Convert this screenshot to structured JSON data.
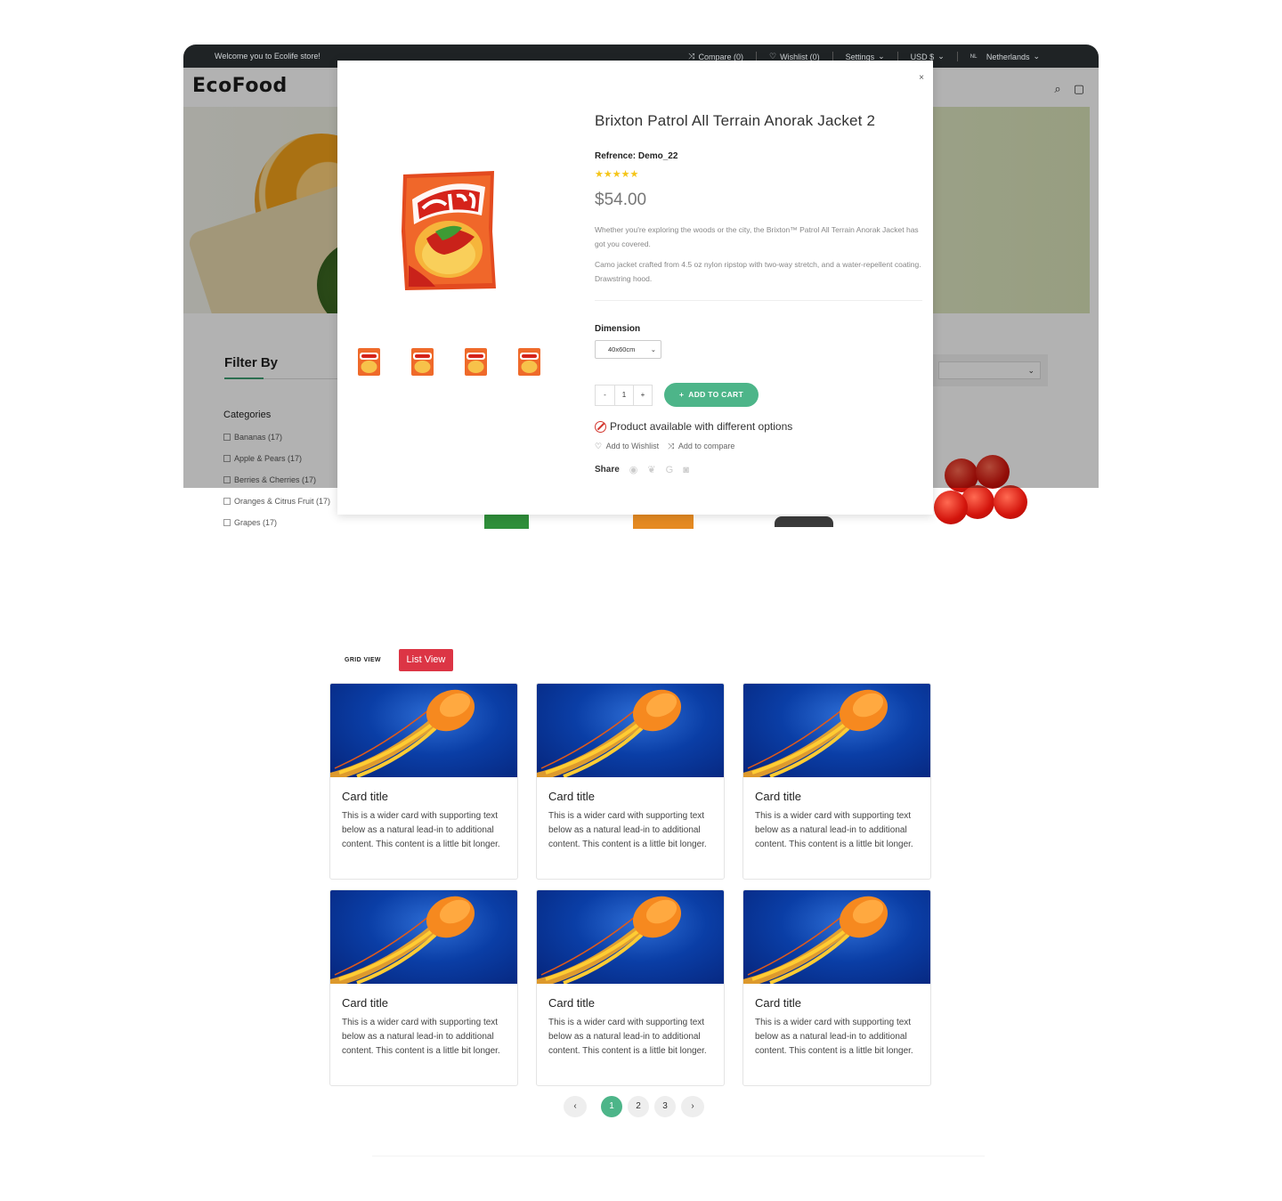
{
  "topbar": {
    "welcome": "Welcome you to Ecolife store!",
    "compare": "Compare (0)",
    "wishlist": "Wishlist (0)",
    "settings": "Settings",
    "currency": "USD $",
    "lang_code": "NL",
    "country": "Netherlands"
  },
  "header": {
    "logo": "EcoFood"
  },
  "sidebar": {
    "filter_title": "Filter By",
    "categories_title": "Categories",
    "categories": [
      "Bananas (17)",
      "Apple & Pears (17)",
      "Berries & Cherries (17)",
      "Oranges & Citrus Fruit (17)",
      "Grapes (17)"
    ]
  },
  "modal": {
    "close": "×",
    "title": "Brixton Patrol All Terrain Anorak Jacket 2",
    "reference_label": "Refrence:",
    "reference_value": "Demo_22",
    "stars": "★★★★★",
    "rating": 5,
    "price": "$54.00",
    "desc1": "Whether you're exploring the woods or the city, the Brixton™ Patrol All Terrain Anorak Jacket has got you covered.",
    "desc2": "Camo jacket crafted from 4.5 oz nylon ripstop with two-way stretch, and a water-repellent coating.",
    "desc3": "Drawstring hood.",
    "dimension_label": "Dimension",
    "dimension_value": "40x60cm",
    "qty_minus": "-",
    "qty_value": "1",
    "qty_plus": "+",
    "add_to_cart": "ADD TO CART",
    "availability": "Product available with different options",
    "wishlist": "Add to Wishlist",
    "compare": "Add to compare",
    "share": "Share"
  },
  "view": {
    "grid": "GRID VIEW",
    "list": "List View"
  },
  "cards": [
    {
      "title": "Card title",
      "text": "This is a wider card with supporting text below as a natural lead-in to additional content. This content is a little bit longer."
    },
    {
      "title": "Card title",
      "text": "This is a wider card with supporting text below as a natural lead-in to additional content. This content is a little bit longer."
    },
    {
      "title": "Card title",
      "text": "This is a wider card with supporting text below as a natural lead-in to additional content. This content is a little bit longer."
    },
    {
      "title": "Card title",
      "text": "This is a wider card with supporting text below as a natural lead-in to additional content. This content is a little bit longer."
    },
    {
      "title": "Card title",
      "text": "This is a wider card with supporting text below as a natural lead-in to additional content. This content is a little bit longer."
    },
    {
      "title": "Card title",
      "text": "This is a wider card with supporting text below as a natural lead-in to additional content. This content is a little bit longer."
    }
  ],
  "pagination": {
    "prev": "‹",
    "pages": [
      "1",
      "2",
      "3"
    ],
    "next": "›",
    "current": "1"
  },
  "colors": {
    "accent_green": "#4db589",
    "list_view_red": "#dc3545",
    "topbar_dark": "#1f2325"
  }
}
